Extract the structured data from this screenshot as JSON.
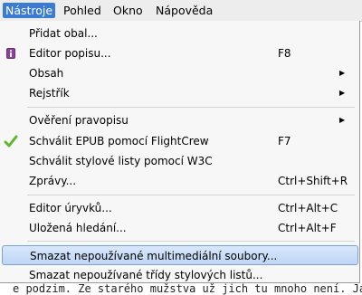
{
  "menubar": {
    "items": [
      {
        "label": "Nástroje",
        "active": true
      },
      {
        "label": "Pohled",
        "active": false
      },
      {
        "label": "Okno",
        "active": false
      },
      {
        "label": "Nápověda",
        "active": false
      }
    ]
  },
  "menu": {
    "items": [
      {
        "label": "Přidat obal...",
        "shortcut": "",
        "submenu": false,
        "icon": ""
      },
      {
        "label": "Editor popisu...",
        "shortcut": "F8",
        "submenu": false,
        "icon": "info-icon"
      },
      {
        "label": "Obsah",
        "shortcut": "",
        "submenu": true,
        "icon": ""
      },
      {
        "label": "Rejstřík",
        "shortcut": "",
        "submenu": true,
        "icon": ""
      },
      {
        "label": "Ověření pravopisu",
        "shortcut": "",
        "submenu": true,
        "icon": ""
      },
      {
        "label": "Schválit EPUB pomocí FlightCrew",
        "shortcut": "F7",
        "submenu": false,
        "icon": "checkmark-icon"
      },
      {
        "label": "Schválit stylové listy pomocí W3C",
        "shortcut": "",
        "submenu": false,
        "icon": ""
      },
      {
        "label": "Zprávy...",
        "shortcut": "Ctrl+Shift+R",
        "submenu": false,
        "icon": ""
      },
      {
        "label": "Editor úryvků...",
        "shortcut": "Ctrl+Alt+C",
        "submenu": false,
        "icon": ""
      },
      {
        "label": "Uložená hledání...",
        "shortcut": "Ctrl+Alt+F",
        "submenu": false,
        "icon": ""
      },
      {
        "label": "Smazat nepoužívané multimediální soubory...",
        "shortcut": "",
        "submenu": false,
        "icon": "",
        "highlighted": true
      },
      {
        "label": "Smazat nepoužívané třídy stylových listů...",
        "shortcut": "",
        "submenu": false,
        "icon": ""
      }
    ],
    "arrow_glyph": "▶"
  },
  "background": {
    "text": "e podzim. Ze starého mužstva už jich tu mnoho není. Já js"
  },
  "colors": {
    "highlight": "#3a7bd5",
    "checkmark": "#5cb82a",
    "info_icon": "#6b2c7a"
  }
}
